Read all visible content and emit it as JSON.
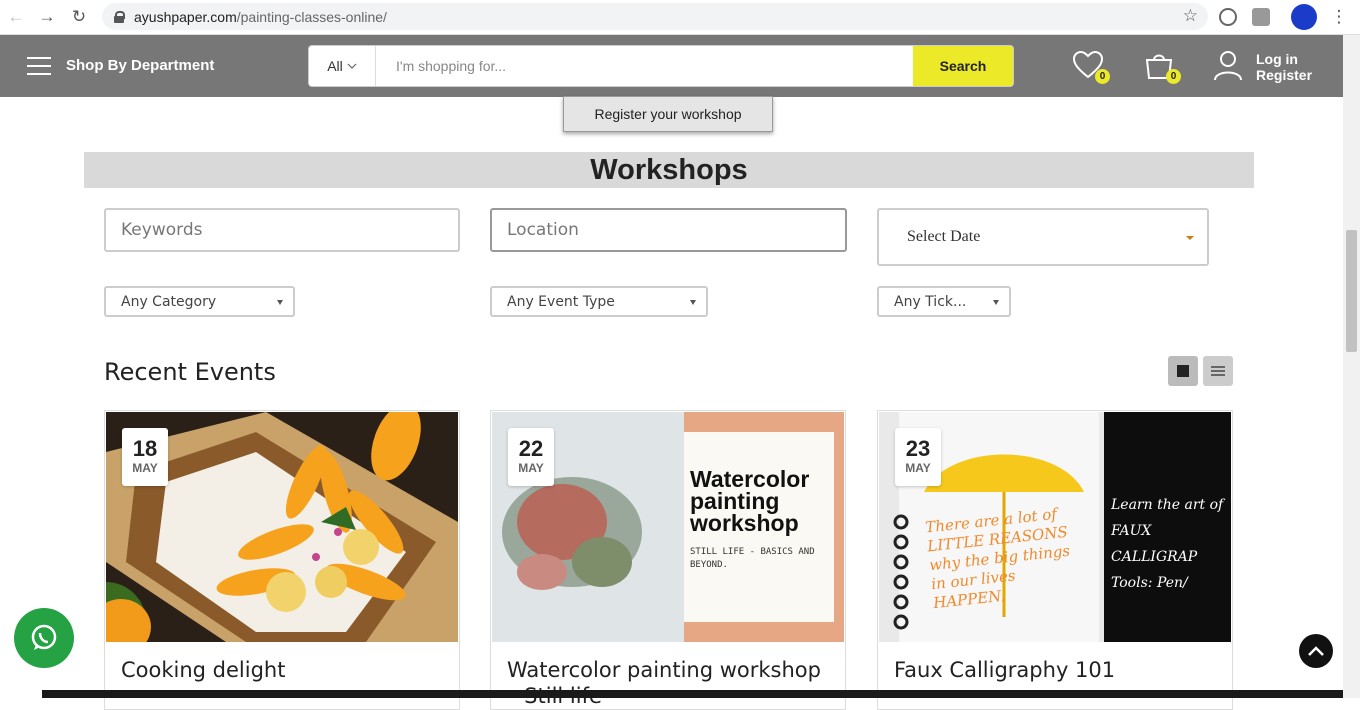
{
  "browser": {
    "url_domain": "ayushpaper.com",
    "url_path": "/painting-classes-online/"
  },
  "header": {
    "dept_label": "Shop By Department",
    "search_category": "All",
    "search_placeholder": "I'm shopping for...",
    "search_button": "Search",
    "wishlist_count": "0",
    "cart_count": "0",
    "login_label": "Log in",
    "register_label": "Register"
  },
  "page": {
    "register_workshop": "Register your workshop",
    "heading": "Workshops"
  },
  "filters": {
    "keywords_placeholder": "Keywords",
    "location_placeholder": "Location",
    "select_date": "Select Date",
    "category": "Any Category",
    "event_type": "Any Event Type",
    "ticket": "Any Tick..."
  },
  "recent": {
    "title": "Recent Events",
    "events": [
      {
        "day": "18",
        "month": "MAY",
        "title": "Cooking delight"
      },
      {
        "day": "22",
        "month": "MAY",
        "title": "Watercolor painting workshop – Still life",
        "img_heading": "Watercolor painting workshop",
        "img_sub": "STILL LIFE - BASICS AND BEYOND."
      },
      {
        "day": "23",
        "month": "MAY",
        "title": "Faux Calligraphy 101",
        "img_text": "There are a lot of LITTLE REASONS why the big things in our lives HAPPEN.",
        "img_side": "Learn the art of FAUX CALLIGRAP Tools: Pen/ Sketch or Brush Pen"
      }
    ]
  },
  "colors": {
    "header_bg": "#777777",
    "accent_yellow": "#ecea28",
    "whatsapp_green": "#25a244"
  }
}
